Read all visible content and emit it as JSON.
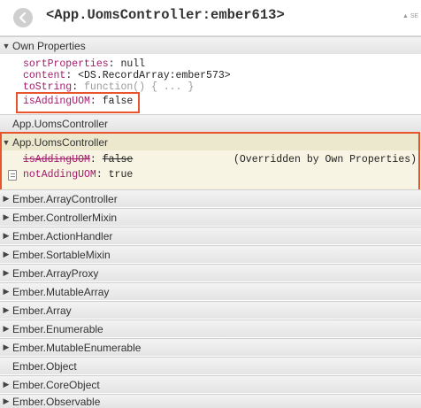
{
  "header": {
    "title": "<App.UomsController:ember613>",
    "hint": "▲ SE",
    "back_icon": "chevron-left-icon"
  },
  "own": {
    "label": "Own Properties",
    "props": [
      {
        "key": "sortProperties",
        "value": "null"
      },
      {
        "key": "content",
        "value": "<DS.RecordArray:ember573>"
      },
      {
        "key": "toString",
        "value": "function() { ... }"
      },
      {
        "key": "isAddingUOM",
        "value": "false"
      }
    ]
  },
  "mixins": [
    {
      "label": "App.UomsController",
      "arrow": ""
    },
    {
      "label": "App.UomsController",
      "arrow": "▼"
    },
    {
      "label": "Ember.ArrayController",
      "arrow": "▶"
    },
    {
      "label": "Ember.ControllerMixin",
      "arrow": "▶"
    },
    {
      "label": "Ember.ActionHandler",
      "arrow": "▶"
    },
    {
      "label": "Ember.SortableMixin",
      "arrow": "▶"
    },
    {
      "label": "Ember.ArrayProxy",
      "arrow": "▶"
    },
    {
      "label": "Ember.MutableArray",
      "arrow": "▶"
    },
    {
      "label": "Ember.Array",
      "arrow": "▶"
    },
    {
      "label": "Ember.Enumerable",
      "arrow": "▶"
    },
    {
      "label": "Ember.MutableEnumerable",
      "arrow": "▶"
    },
    {
      "label": "Ember.Object",
      "arrow": ""
    },
    {
      "label": "Ember.CoreObject",
      "arrow": "▶"
    },
    {
      "label": "Ember.Observable",
      "arrow": "▶"
    }
  ],
  "controller": {
    "props": [
      {
        "key": "isAddingUOM",
        "value": "false",
        "note": "(Overridden by Own Properties)"
      },
      {
        "key": "notAddingUOM",
        "value": "true"
      }
    ]
  },
  "colors": {
    "highlight": "#e8542b",
    "key": "#a31c6b",
    "expanded_bg": "#f7f4e3"
  }
}
